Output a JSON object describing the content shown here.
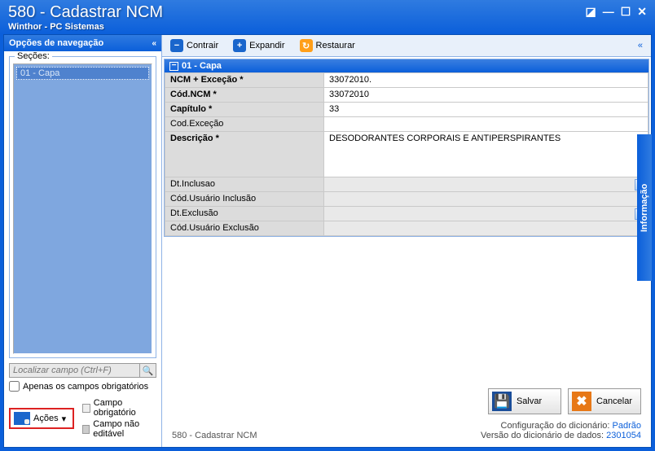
{
  "window": {
    "title": "580 - Cadastrar  NCM",
    "subtitle": "Winthor - PC Sistemas"
  },
  "sidebar": {
    "header": "Opções de navegação",
    "sections_label": "Seções:",
    "tree": {
      "item1": "01 - Capa"
    },
    "find_placeholder": "Localizar campo (Ctrl+F)",
    "only_required": "Apenas os campos obrigatórios",
    "actions_btn": "Ações",
    "legend_required": "Campo obrigatório",
    "legend_readonly": "Campo não editável"
  },
  "toolbar": {
    "contrair": "Contrair",
    "expandir": "Expandir",
    "restaurar": "Restaurar"
  },
  "section": {
    "title": "01 - Capa"
  },
  "fields": {
    "ncm_excecao_lbl": "NCM + Exceção *",
    "ncm_excecao_val": "33072010.",
    "codncm_lbl": "Cód.NCM *",
    "codncm_val": "33072010",
    "capitulo_lbl": "Capítulo *",
    "capitulo_val": "33",
    "codexcecao_lbl": "Cod.Exceção",
    "codexcecao_val": "",
    "descricao_lbl": "Descrição *",
    "descricao_val": "DESODORANTES CORPORAIS E ANTIPERSPIRANTES",
    "dtinclusao_lbl": "Dt.Inclusao",
    "codusr_inc_lbl": "Cód.Usuário Inclusão",
    "dtexclusao_lbl": "Dt.Exclusão",
    "codusr_exc_lbl": "Cód.Usuário Exclusão"
  },
  "buttons": {
    "salvar": "Salvar",
    "cancelar": "Cancelar"
  },
  "status": {
    "left": "580 - Cadastrar  NCM",
    "config_lbl": "Configuração do dicionário:",
    "config_val": "Padrão",
    "ver_lbl": "Versão do dicionário de dados:",
    "ver_val": "2301054"
  },
  "info_tab": "Informação"
}
